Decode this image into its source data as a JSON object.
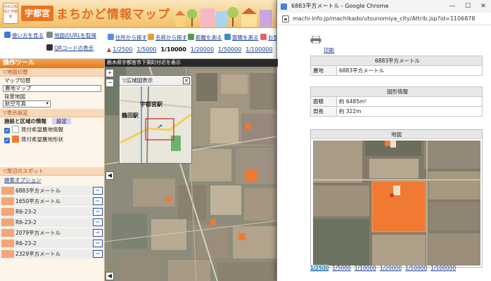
{
  "app": {
    "brand_badge": "住めば愉快だ宇都宮",
    "brand_name": "宇都宮",
    "title": "まちかど情報マップ",
    "toolbar": {
      "help": "使い方を見る",
      "map_url": "地図のURLを取得",
      "qr": "QRコードの表示",
      "search_address": "住所から探す",
      "search_name": "名称から探す",
      "measure_distance": "距離を測る",
      "measure_area": "面積を測る",
      "more": "お気"
    },
    "scales": [
      "1/2500",
      "1/5000",
      "1/10000",
      "1/20000",
      "1/50000",
      "1/100000",
      "1/2"
    ],
    "selected_scale": "1/10000",
    "sidebar": {
      "title": "操作ツール",
      "map_switch_head": "▽地図切替",
      "map_switch_label": "マップ切替",
      "map_value": "農地マップ",
      "bg_label": "背景地図",
      "bg_value": "航空写真",
      "display_head": "▽表示設定",
      "tab_info": "施設と区域の情報",
      "tab_settings": "設定",
      "layer1": "賃付希望農地情報",
      "layer2": "賃付希望農地形状",
      "nearby_head": "▽周辺のスポット",
      "search_options": "検索オプション",
      "spots": [
        "6883平方メートル",
        "1650平方メートル",
        "R6-23-2",
        "R6-23-2",
        "2079平方メートル",
        "R6-23-2",
        "2329平方メートル"
      ]
    },
    "map": {
      "location": "栃木県宇都宮市下栗町付近を表示",
      "overview_title": "▽広域図表示",
      "overview_close": "×",
      "station1": "宇都宮駅",
      "station2": "鶴田駅"
    }
  },
  "popup": {
    "window_title": "6883平方メートル - Google Chrome",
    "url": "machi-info.jp/machikado/utsunomiya_city/Attrib.jsp?id=1106878",
    "print": "印刷",
    "info_title": "6883平方メートル",
    "info_key": "農地",
    "info_value": "6883平方メートル",
    "shape_title": "図形情報",
    "area_key": "面積",
    "area_value": "約 6485m²",
    "perimeter_key": "周長",
    "perimeter_value": "約 322m",
    "photo_title": "地図",
    "scales": [
      "1/2500",
      "1/5000",
      "1/10000",
      "1/20000",
      "1/50000",
      "1/100000"
    ],
    "selected_scale": "1/2500"
  },
  "colors": {
    "accent": "#e9751f",
    "farm": "#f07a32",
    "link": "#1a3d8f"
  }
}
